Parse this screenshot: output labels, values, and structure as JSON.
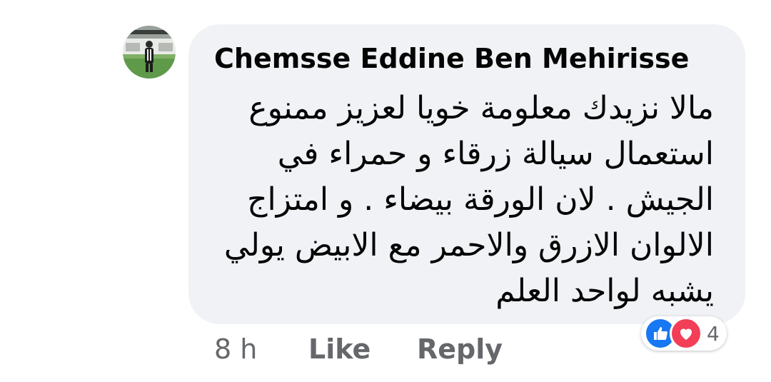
{
  "comment": {
    "author_name": "Chemsse Eddine Ben Mehirisse",
    "text_lines": [
      "مالا نزيدك معلومة خويا لعزيز ممنوع",
      "استعمال سيالة زرقاء و حمراء في",
      "الجيش . لان الورقة بيضاء . و امتزاج",
      "الالوان الازرق والاحمر مع الابيض يولي",
      "يشبه لواحد العلم"
    ],
    "avatar_icon": "user-avatar-photo"
  },
  "footer": {
    "timestamp": "8 h",
    "like_label": "Like",
    "reply_label": "Reply"
  },
  "reactions": {
    "count": "4",
    "types": [
      "like",
      "love"
    ],
    "colors": {
      "like": "#1877f2",
      "love": "#f33e58"
    }
  },
  "colors": {
    "bubble_background": "#f0f2f5",
    "text": "#050505",
    "secondary_text": "#65676b"
  }
}
